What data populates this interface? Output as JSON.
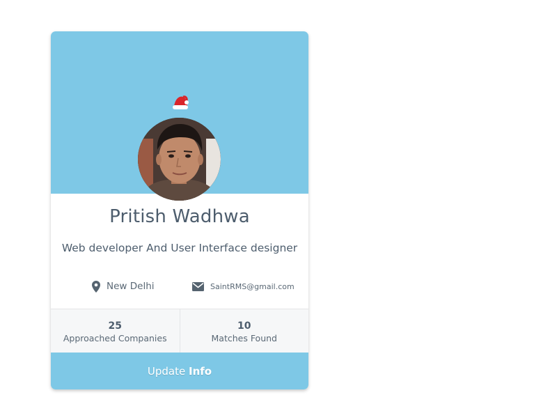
{
  "profile": {
    "name": "Pritish Wadhwa",
    "title": "Web developer And User Interface designer",
    "location": "New Delhi",
    "email": "SaintRMS@gmail.com",
    "avatar_icon": "santa-hat-icon"
  },
  "stats": [
    {
      "value": "25",
      "label": "Approached Companies"
    },
    {
      "value": "10",
      "label": "Matches Found"
    }
  ],
  "button": {
    "label_prefix": "Update",
    "label_bold": "Info"
  },
  "colors": {
    "accent": "#7ec8e6",
    "text": "#4d5d6d"
  }
}
